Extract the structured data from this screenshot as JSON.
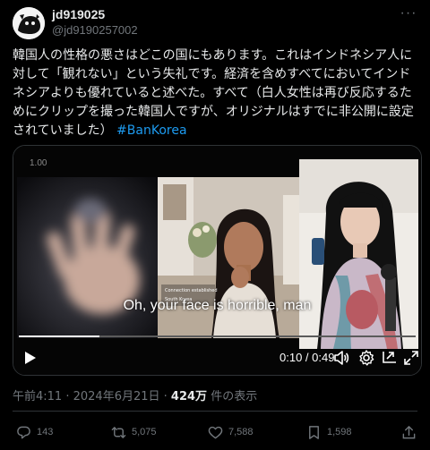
{
  "author": {
    "name": "jd919025",
    "handle": "@jd9190257002"
  },
  "tweet": {
    "text_main": "韓国人の性格の悪さはどこの国にもあります。これはインドネシア人に対して「観れない」という失礼です。経済を含めすべてにおいてインドネシアよりも優れていると述べた。すべて（白人女性は再び反応するためにクリップを撮った韓国人ですが、オリジナルはすでに非公開に設定されていました）",
    "hashtag": "#BanKorea"
  },
  "video": {
    "speed_label": "1.00",
    "subtitle": "Oh, your face is horrible, man",
    "time": "0:10 / 0:49",
    "progress_fraction": 0.204
  },
  "meta": {
    "time": "午前4:11",
    "sep1": " · ",
    "date": "2024年6月21日",
    "sep2": " · ",
    "views": "424万",
    "views_suffix": " 件の表示"
  },
  "actions": {
    "replies": "143",
    "reposts": "5,075",
    "likes": "7,588",
    "bookmarks": "1,598"
  },
  "colors": {
    "accent": "#1d9bf0",
    "background": "#000000",
    "text": "#e7e9ea",
    "secondary": "#71767b"
  }
}
